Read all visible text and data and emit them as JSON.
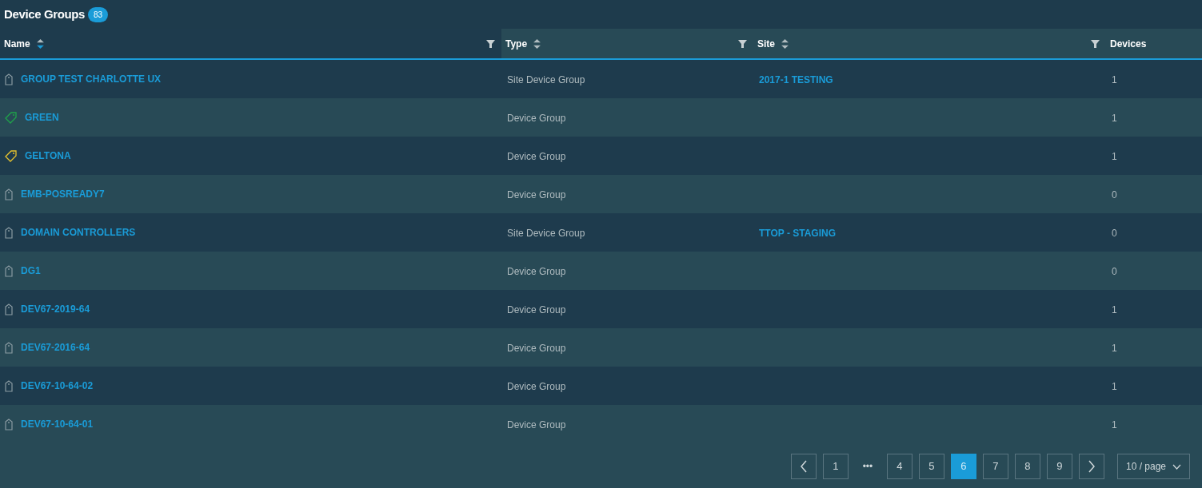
{
  "title": "Device Groups",
  "count": "83",
  "columns": [
    {
      "label": "Name",
      "sortable": true,
      "sorted": true,
      "filter": true
    },
    {
      "label": "Type",
      "sortable": true,
      "sorted": false,
      "filter": true
    },
    {
      "label": "Site",
      "sortable": true,
      "sorted": false,
      "filter": true
    },
    {
      "label": "Devices",
      "sortable": false,
      "filter": false
    }
  ],
  "rows": [
    {
      "kind": "group",
      "name": "GROUP TEST CHARLOTTE UX",
      "type": "Site Device Group",
      "site": "2017-1 TESTING",
      "devices": "1"
    },
    {
      "kind": "tag",
      "color": "#1fa34a",
      "name": "GREEN",
      "type": "Device Group",
      "devices": "1"
    },
    {
      "kind": "tag",
      "color": "#e8c32e",
      "name": "GELTONA",
      "type": "Device Group",
      "devices": "1"
    },
    {
      "kind": "group",
      "name": "EMB-POSREADY7",
      "type": "Device Group",
      "devices": "0"
    },
    {
      "kind": "group",
      "name": "DOMAIN CONTROLLERS",
      "type": "Site Device Group",
      "site": "TTOP - STAGING",
      "devices": "0"
    },
    {
      "kind": "group",
      "name": "DG1",
      "type": "Device Group",
      "devices": "0"
    },
    {
      "kind": "group",
      "name": "DEV67-2019-64",
      "type": "Device Group",
      "devices": "1"
    },
    {
      "kind": "group",
      "name": "DEV67-2016-64",
      "type": "Device Group",
      "devices": "1"
    },
    {
      "kind": "group",
      "name": "DEV67-10-64-02",
      "type": "Device Group",
      "devices": "1"
    },
    {
      "kind": "group",
      "name": "DEV67-10-64-01",
      "type": "Device Group",
      "devices": "1"
    }
  ],
  "pagination": {
    "pages": [
      {
        "label": "1",
        "selected": false
      },
      {
        "label": "•••",
        "kind": "ellipsis"
      },
      {
        "label": "4",
        "selected": false
      },
      {
        "label": "5",
        "selected": false
      },
      {
        "label": "6",
        "selected": true
      },
      {
        "label": "7",
        "selected": false
      },
      {
        "label": "8",
        "selected": false
      },
      {
        "label": "9",
        "selected": false
      }
    ],
    "page_size": "10 / page"
  }
}
